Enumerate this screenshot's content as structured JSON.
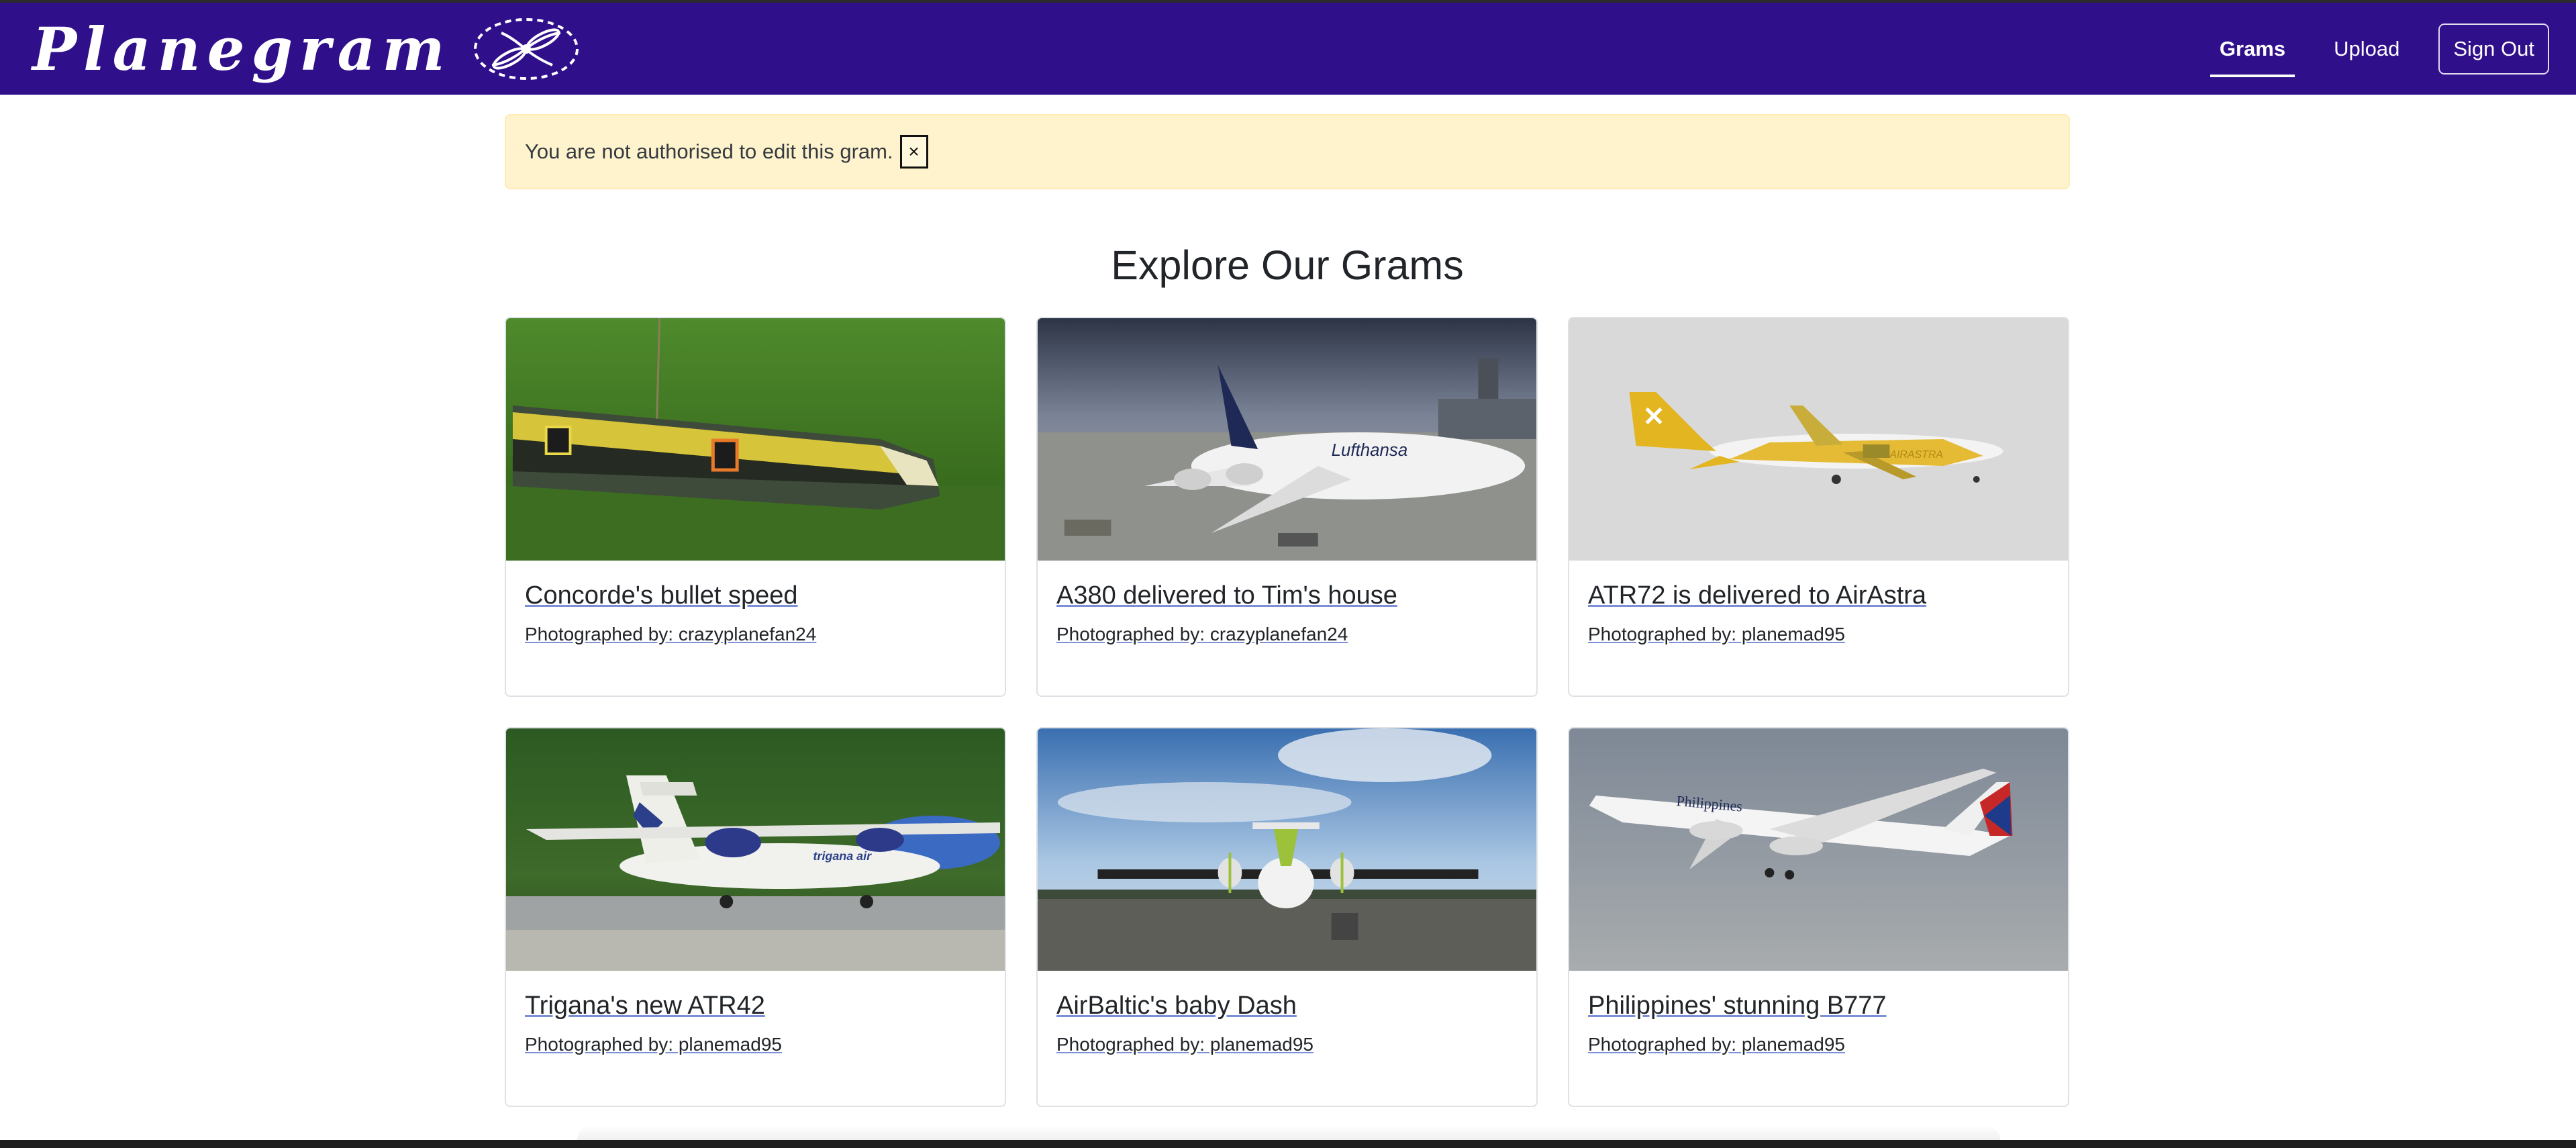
{
  "navbar": {
    "brand": "Planegram",
    "logo_icon": "propeller-logo-icon",
    "links": [
      {
        "label": "Grams",
        "active": true
      },
      {
        "label": "Upload",
        "active": false
      }
    ],
    "signout_label": "Sign Out",
    "background": "#2f0f8a"
  },
  "alert": {
    "message": "You are not authorised to edit this gram.",
    "close_symbol": "×",
    "background": "#fff3cd"
  },
  "page": {
    "title": "Explore Our Grams"
  },
  "cards": [
    {
      "title": "Concorde's bullet speed",
      "author": "Photographed by: crazyplanefan24",
      "image": "yellow-train-photo"
    },
    {
      "title": "A380 delivered to Tim's house",
      "author": "Photographed by: crazyplanefan24",
      "image": "lufthansa-a380-photo"
    },
    {
      "title": "ATR72 is delivered to AirAstra",
      "author": "Photographed by: planemad95",
      "image": "airastra-atr72-photo"
    },
    {
      "title": "Trigana's new ATR42",
      "author": "Photographed by: planemad95",
      "image": "trigana-atr42-photo"
    },
    {
      "title": "AirBaltic's baby Dash",
      "author": "Photographed by: planemad95",
      "image": "airbaltic-dash-photo"
    },
    {
      "title": "Philippines' stunning B777",
      "author": "Photographed by: planemad95",
      "image": "philippines-b777-photo"
    }
  ]
}
